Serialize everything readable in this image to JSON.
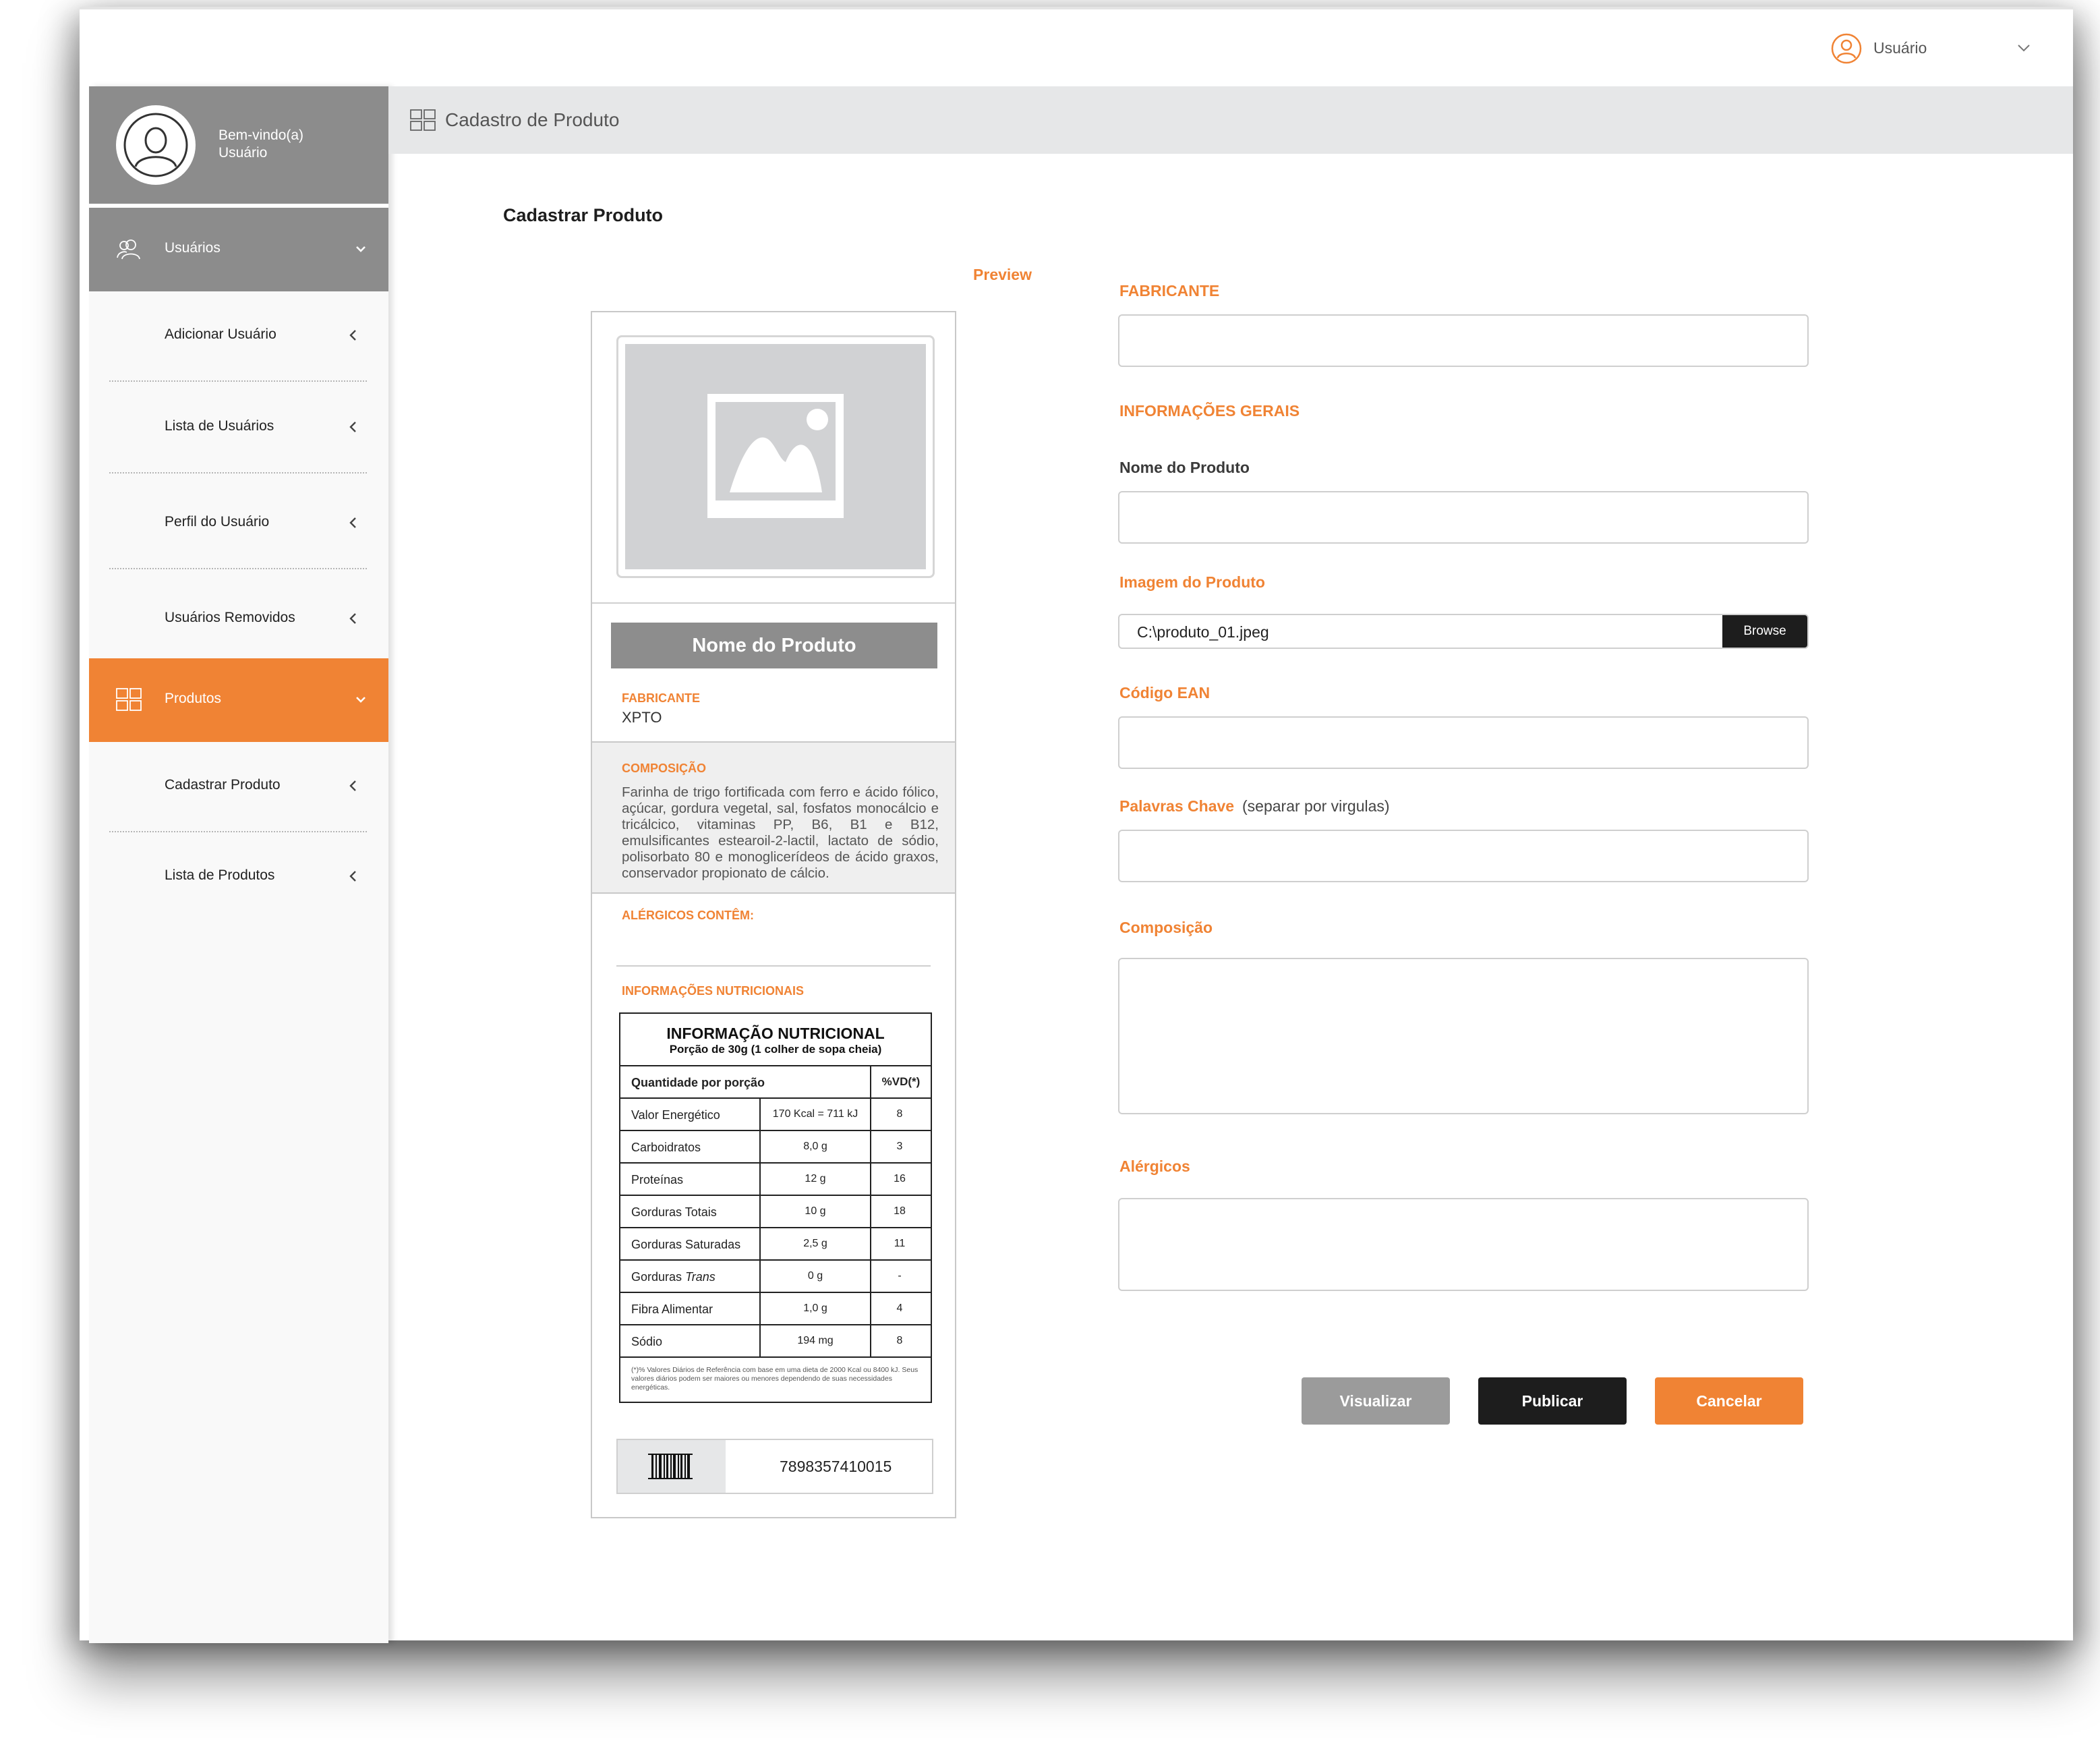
{
  "topbar": {
    "user_label": "Usuário"
  },
  "sidebar": {
    "welcome_line1": "Bem-vindo(a)",
    "welcome_line2": "Usuário",
    "groups": [
      {
        "label": "Usuários",
        "icon": "users-icon"
      },
      {
        "label": "Produtos",
        "icon": "grid-icon"
      }
    ],
    "users_items": [
      "Adicionar Usuário",
      "Lista de Usuários",
      "Perfil do Usuário",
      "Usuários Removidos"
    ],
    "products_items": [
      "Cadastrar Produto",
      "Lista de Produtos"
    ]
  },
  "header": {
    "title": "Cadastro de Produto"
  },
  "main": {
    "title": "Cadastrar Produto",
    "preview_label": "Preview"
  },
  "preview": {
    "product_name": "Nome do Produto",
    "manufacturer_label": "FABRICANTE",
    "manufacturer_value": "XPTO",
    "composition_label": "COMPOSIÇÃO",
    "composition_text": "Farinha de trigo fortificada com ferro e ácido fólico, açúcar, gordura vegetal, sal, fosfatos monocálcio e tricálcico, vitaminas PP, B6, B1 e B12, emulsificantes estearoil-2-lactil, lactato de sódio, polisorbato 80 e monoglicerídeos de ácido graxos, conservador propionato de cálcio.",
    "allergens_label": "ALÉRGICOS CONTÊM:",
    "nutrition_section_label": "INFORMAÇÕES NUTRICIONAIS",
    "nutrition": {
      "title": "INFORMAÇÃO NUTRICIONAL",
      "portion": "Porção de 30g (1 colher de sopa cheia)",
      "col_quantity": "Quantidade por porção",
      "col_vd": "%VD(*)",
      "rows": [
        {
          "name": "Valor Energético",
          "amount": "170 Kcal = 711 kJ",
          "vd": "8"
        },
        {
          "name": "Carboidratos",
          "amount": "8,0 g",
          "vd": "3"
        },
        {
          "name": "Proteínas",
          "amount": "12 g",
          "vd": "16"
        },
        {
          "name": "Gorduras Totais",
          "amount": "10 g",
          "vd": "18"
        },
        {
          "name": "Gorduras Saturadas",
          "amount": "2,5 g",
          "vd": "11"
        },
        {
          "name": "Gorduras",
          "name_italic": "Trans",
          "amount": "0 g",
          "vd": "-"
        },
        {
          "name": "Fibra Alimentar",
          "amount": "1,0 g",
          "vd": "4"
        },
        {
          "name": "Sódio",
          "amount": "194 mg",
          "vd": "8"
        }
      ],
      "footnote": "(*)% Valores Diários de Referência com base em uma dieta de 2000 Kcal ou 8400 kJ. Seus valores diários podem ser maiores ou menores dependendo de suas necessidades energéticas."
    },
    "barcode_number": "7898357410015"
  },
  "form": {
    "manufacturer_label": "FABRICANTE",
    "general_label": "INFORMAÇÕES GERAIS",
    "product_name_label": "Nome do Produto",
    "image_label": "Imagem do Produto",
    "image_path": "C:\\produto_01.jpeg",
    "browse_label": "Browse",
    "ean_label": "Código EAN",
    "keywords_label": "Palavras Chave",
    "keywords_hint": "(separar por virgulas)",
    "composition_label": "Composição",
    "allergens_label": "Alérgicos"
  },
  "buttons": {
    "preview": "Visualizar",
    "publish": "Publicar",
    "cancel": "Cancelar"
  },
  "colors": {
    "accent": "#f08334",
    "sidebar_gray": "#8c8c8c",
    "dark": "#1d1d1d",
    "header_bg": "#e6e7e8"
  }
}
